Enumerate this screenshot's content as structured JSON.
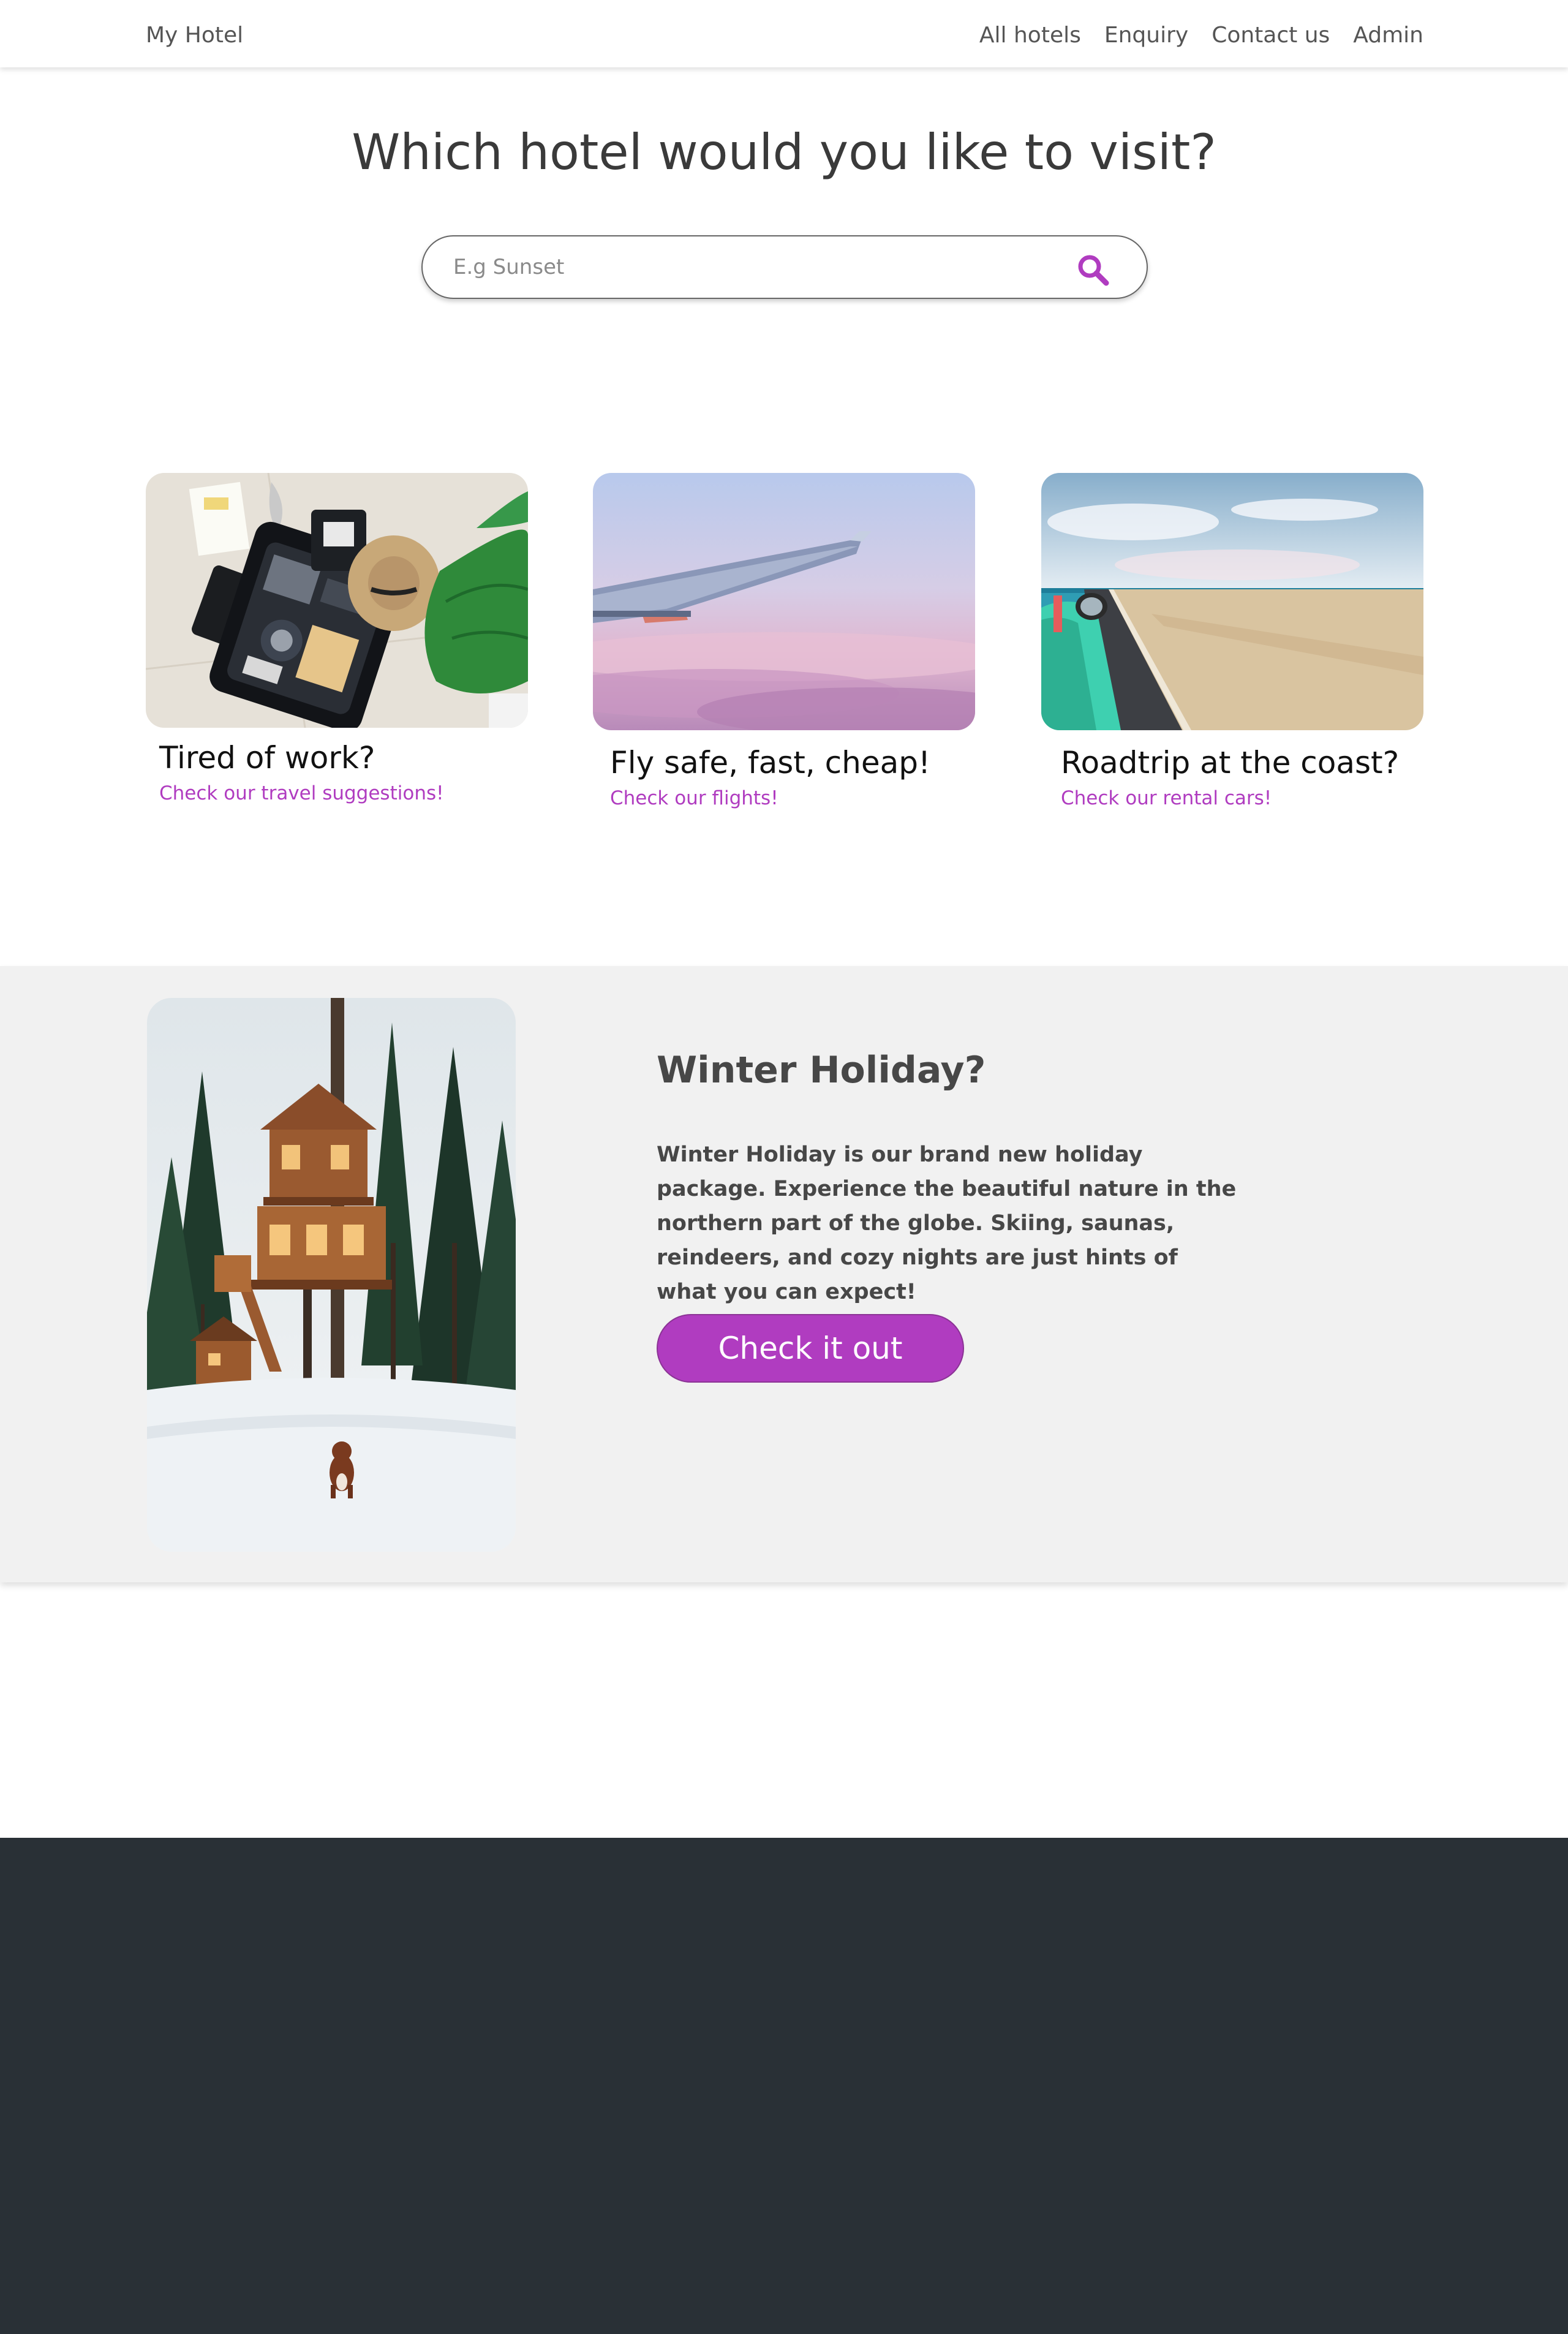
{
  "navbar": {
    "brand": "My Hotel",
    "links": [
      "All hotels",
      "Enquiry",
      "Contact us",
      "Admin"
    ]
  },
  "hero": {
    "title": "Which hotel would you like to visit?",
    "search_placeholder": "E.g Sunset",
    "search_value": ""
  },
  "cards": [
    {
      "title": "Tired of work?",
      "link": "Check our travel suggestions!"
    },
    {
      "title": "Fly safe, fast, cheap!",
      "link": "Check our flights!"
    },
    {
      "title": "Roadtrip at the coast?",
      "link": "Check our rental cars!"
    }
  ],
  "promo": {
    "title": "Winter Holiday?",
    "text": "Winter Holiday is our brand new holiday package. Experience the beautiful nature in the northern part of the globe. Skiing, saunas, reindeers, and cozy nights are just hints of what you can expect!",
    "button_label": "Check it out"
  },
  "colors": {
    "accent": "#b03cc0",
    "promo_bg": "#f1f1f1",
    "footer_bg": "#293036"
  },
  "icons": {
    "search": "search-icon"
  }
}
